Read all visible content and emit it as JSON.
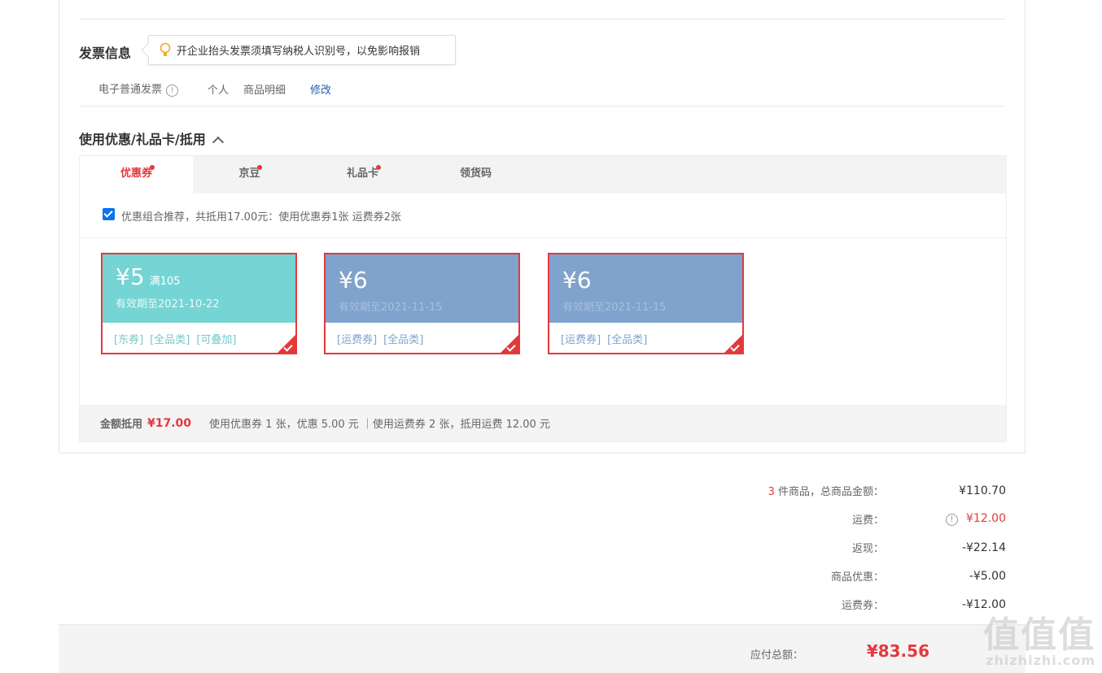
{
  "invoice": {
    "title": "发票信息",
    "tip": "开企业抬头发票须填写纳税人识别号，以免影响报销",
    "type": "电子普通发票",
    "holder": "个人",
    "content": "商品明细",
    "edit": "修改"
  },
  "discount": {
    "title": "使用优惠/礼品卡/抵用",
    "tabs": [
      {
        "label": "优惠券",
        "dot": true
      },
      {
        "label": "京豆",
        "dot": true
      },
      {
        "label": "礼品卡",
        "dot": true
      },
      {
        "label": "领货码",
        "dot": false
      }
    ],
    "recommend": "优惠组合推荐，共抵用17.00元：使用优惠券1张 运费券2张",
    "coupons": [
      {
        "amount": "¥5",
        "condition": "满105",
        "date": "有效期至2021-10-22",
        "tags": [
          "[东券]",
          "[全品类]",
          "[可叠加]"
        ]
      },
      {
        "amount": "¥6",
        "condition": "",
        "date": "有效期至2021-11-15",
        "tags": [
          "[运费券]",
          "[全品类]"
        ]
      },
      {
        "amount": "¥6",
        "condition": "",
        "date": "有效期至2021-11-15",
        "tags": [
          "[运费券]",
          "[全品类]"
        ]
      }
    ],
    "summary_label": "金额抵用",
    "summary_amount": "¥17.00",
    "summary_detail": "使用优惠券 1 张，优惠 5.00 元 ｜使用运费券 2 张，抵用运费 12.00 元"
  },
  "totals": {
    "count": "3",
    "items_label": " 件商品，总商品金额：",
    "items_value": "¥110.70",
    "shipping_label": "运费：",
    "shipping_value": "¥12.00",
    "cashback_label": "返现：",
    "cashback_value": "-¥22.14",
    "promo_label": "商品优惠：",
    "promo_value": "-¥5.00",
    "shipcoupon_label": "运费券：",
    "shipcoupon_value": "-¥12.00"
  },
  "pay": {
    "label": "应付总额：",
    "amount": "¥83.56"
  },
  "watermark": {
    "big": "值值值",
    "small": "zhizhizhi.com"
  },
  "colors": {
    "accent": "#e4393c",
    "teal": "#75d4d4",
    "blue": "#7fa3cc",
    "link": "#1f5fa8"
  }
}
